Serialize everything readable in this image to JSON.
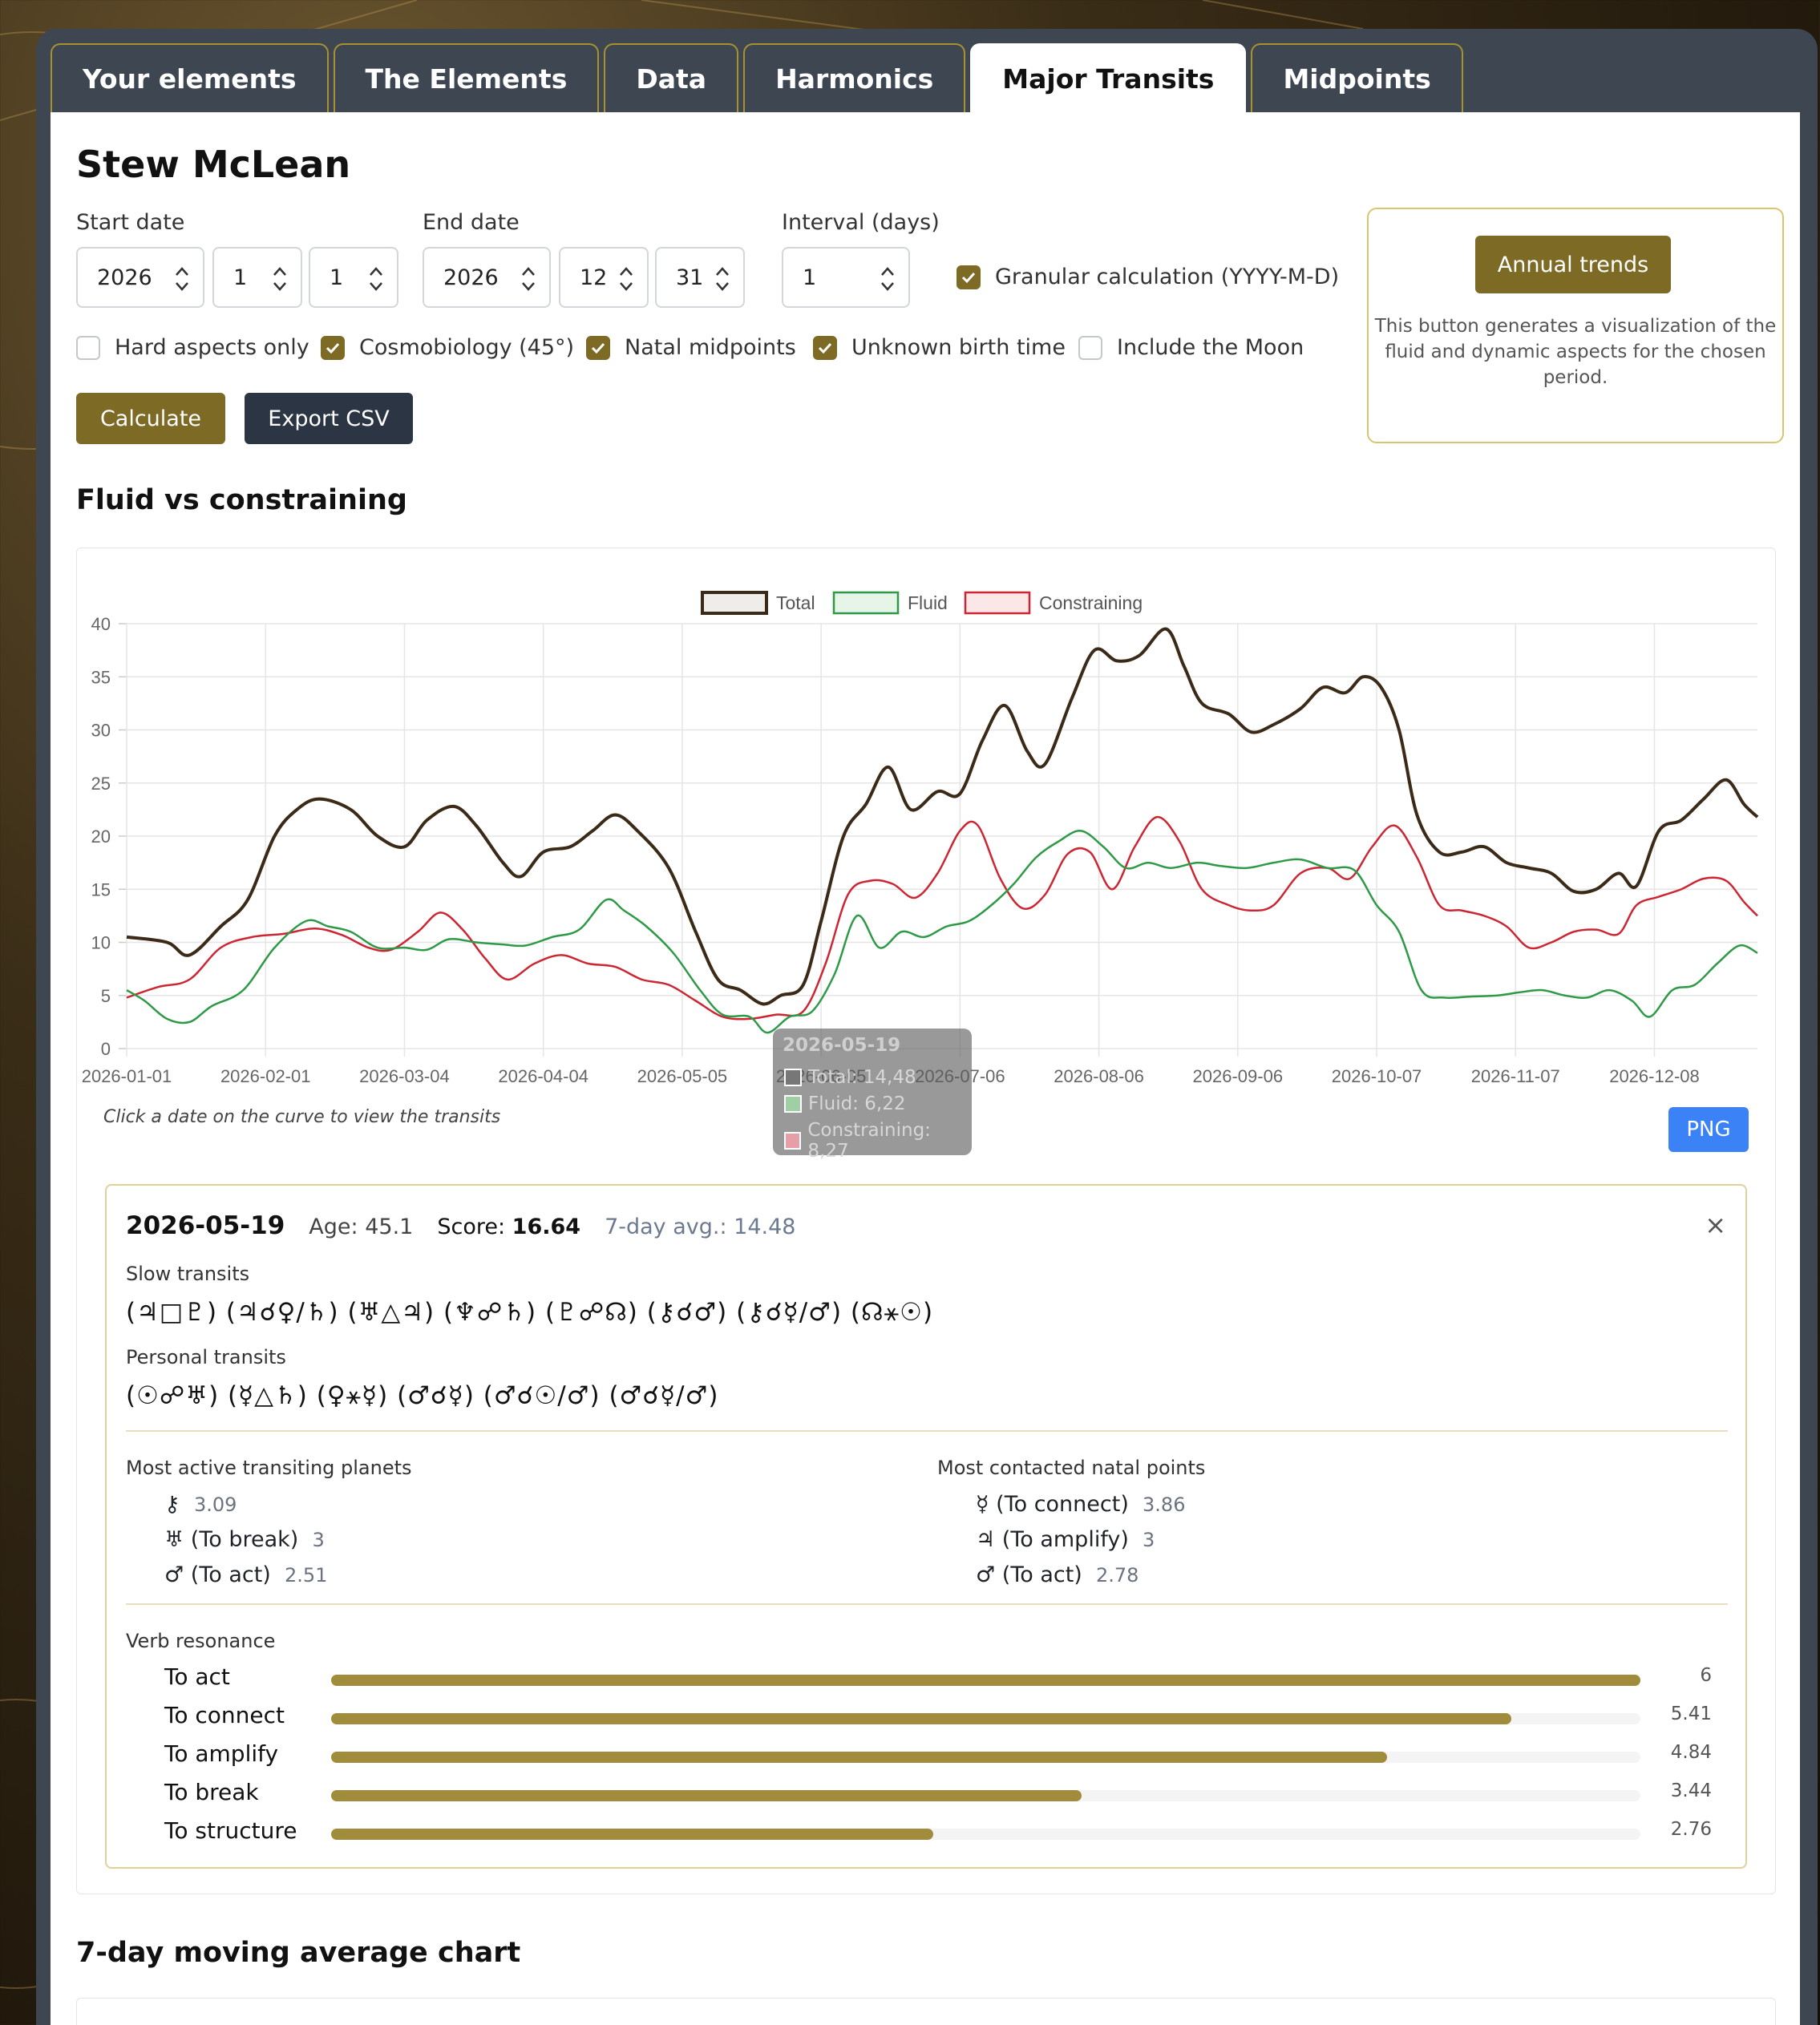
{
  "tabs": [
    {
      "label": "Your elements",
      "active": false
    },
    {
      "label": "The Elements",
      "active": false
    },
    {
      "label": "Data",
      "active": false
    },
    {
      "label": "Harmonics",
      "active": false
    },
    {
      "label": "Major Transits",
      "active": true
    },
    {
      "label": "Midpoints",
      "active": false
    }
  ],
  "person_name": "Stew McLean",
  "form": {
    "start_label": "Start date",
    "start": {
      "year": "2026",
      "month": "1",
      "day": "1"
    },
    "end_label": "End date",
    "end": {
      "year": "2026",
      "month": "12",
      "day": "31"
    },
    "interval_label": "Interval (days)",
    "interval": "1",
    "granular_label": "Granular calculation (YYYY-M-D)",
    "options": {
      "hard_aspects": "Hard aspects only",
      "cosmobiology": "Cosmobiology (45°)",
      "natal_midpoints": "Natal midpoints",
      "unknown_birth": "Unknown birth time",
      "include_moon": "Include the Moon"
    },
    "calculate_label": "Calculate",
    "export_label": "Export CSV"
  },
  "trends": {
    "button_label": "Annual trends",
    "line1": "This button generates a visualization of the",
    "line2": "fluid and dynamic aspects for the chosen",
    "line3": "period."
  },
  "chart_title": "Fluid vs constraining",
  "chart_hint": "Click a date on the curve to view the transits",
  "png_label": "PNG",
  "colors": {
    "accent": "#7d6a24",
    "dark": "#2c3544",
    "blue": "#3b82f6",
    "total": "#3b2a17",
    "fluid": "#2e9a47",
    "constraining": "#cc2633"
  },
  "tooltip": {
    "date": "2026-05-19",
    "total": "Total: 14,48",
    "fluid": "Fluid: 6,22",
    "constraining": "Constraining: 8,27"
  },
  "chart_data": {
    "type": "line",
    "legend": [
      "Total",
      "Fluid",
      "Constraining"
    ],
    "legend_placement": "top",
    "ylim": [
      0,
      40
    ],
    "y_ticks": [
      "0",
      "5",
      "10",
      "15",
      "20",
      "25",
      "30",
      "35",
      "40"
    ],
    "x_ticks": [
      "2026-01-01",
      "2026-02-01",
      "2026-03-04",
      "2026-04-04",
      "2026-05-05",
      "2026-06-05",
      "2026-07-06",
      "2026-08-06",
      "2026-09-06",
      "2026-10-07",
      "2026-11-07",
      "2026-12-08"
    ],
    "grid": true,
    "series": [
      {
        "name": "Total",
        "points": [
          [
            "2026-01-01",
            10.5
          ],
          [
            "2026-01-10",
            10
          ],
          [
            "2026-01-15",
            8.8
          ],
          [
            "2026-01-22",
            11.5
          ],
          [
            "2026-01-28",
            14
          ],
          [
            "2026-02-03",
            20
          ],
          [
            "2026-02-08",
            22.5
          ],
          [
            "2026-02-13",
            23.5
          ],
          [
            "2026-02-20",
            22.5
          ],
          [
            "2026-02-26",
            20
          ],
          [
            "2026-03-04",
            19
          ],
          [
            "2026-03-09",
            21.5
          ],
          [
            "2026-03-15",
            22.8
          ],
          [
            "2026-03-20",
            21
          ],
          [
            "2026-03-26",
            17.5
          ],
          [
            "2026-03-30",
            16.2
          ],
          [
            "2026-04-04",
            18.5
          ],
          [
            "2026-04-10",
            19
          ],
          [
            "2026-04-15",
            20.5
          ],
          [
            "2026-04-20",
            22
          ],
          [
            "2026-04-25",
            20.5
          ],
          [
            "2026-05-02",
            17
          ],
          [
            "2026-05-08",
            11
          ],
          [
            "2026-05-13",
            6.5
          ],
          [
            "2026-05-18",
            5.5
          ],
          [
            "2026-05-23",
            4.2
          ],
          [
            "2026-05-27",
            5
          ],
          [
            "2026-06-01",
            6
          ],
          [
            "2026-06-05",
            12
          ],
          [
            "2026-06-10",
            20
          ],
          [
            "2026-06-15",
            23
          ],
          [
            "2026-06-20",
            26.5
          ],
          [
            "2026-06-25",
            22.5
          ],
          [
            "2026-07-01",
            24.2
          ],
          [
            "2026-07-06",
            24
          ],
          [
            "2026-07-11",
            29
          ],
          [
            "2026-07-16",
            32.3
          ],
          [
            "2026-07-21",
            28
          ],
          [
            "2026-07-25",
            26.8
          ],
          [
            "2026-07-31",
            33
          ],
          [
            "2026-08-05",
            37.5
          ],
          [
            "2026-08-10",
            36.5
          ],
          [
            "2026-08-15",
            37
          ],
          [
            "2026-08-21",
            39.5
          ],
          [
            "2026-08-25",
            36
          ],
          [
            "2026-08-29",
            32.5
          ],
          [
            "2026-09-04",
            31.5
          ],
          [
            "2026-09-09",
            29.8
          ],
          [
            "2026-09-14",
            30.5
          ],
          [
            "2026-09-20",
            32
          ],
          [
            "2026-09-25",
            34
          ],
          [
            "2026-09-30",
            33.5
          ],
          [
            "2026-10-04",
            35
          ],
          [
            "2026-10-08",
            34
          ],
          [
            "2026-10-12",
            30
          ],
          [
            "2026-10-16",
            22
          ],
          [
            "2026-10-21",
            18.5
          ],
          [
            "2026-10-26",
            18.5
          ],
          [
            "2026-10-31",
            19
          ],
          [
            "2026-11-05",
            17.5
          ],
          [
            "2026-11-10",
            17
          ],
          [
            "2026-11-15",
            16.5
          ],
          [
            "2026-11-20",
            14.8
          ],
          [
            "2026-11-25",
            15
          ],
          [
            "2026-11-30",
            16.5
          ],
          [
            "2026-12-04",
            15.3
          ],
          [
            "2026-12-09",
            20.5
          ],
          [
            "2026-12-14",
            21.5
          ],
          [
            "2026-12-19",
            23.5
          ],
          [
            "2026-12-24",
            25.3
          ],
          [
            "2026-12-28",
            23
          ],
          [
            "2026-12-31",
            21.8
          ]
        ]
      },
      {
        "name": "Fluid",
        "points": [
          [
            "2026-01-01",
            5.5
          ],
          [
            "2026-01-05",
            4.5
          ],
          [
            "2026-01-10",
            2.8
          ],
          [
            "2026-01-15",
            2.5
          ],
          [
            "2026-01-20",
            4
          ],
          [
            "2026-01-27",
            5.5
          ],
          [
            "2026-02-03",
            9.5
          ],
          [
            "2026-02-10",
            12
          ],
          [
            "2026-02-15",
            11.5
          ],
          [
            "2026-02-20",
            11
          ],
          [
            "2026-02-26",
            9.5
          ],
          [
            "2026-03-04",
            9.5
          ],
          [
            "2026-03-09",
            9.3
          ],
          [
            "2026-03-14",
            10.3
          ],
          [
            "2026-03-20",
            10
          ],
          [
            "2026-03-26",
            9.8
          ],
          [
            "2026-03-31",
            9.7
          ],
          [
            "2026-04-06",
            10.5
          ],
          [
            "2026-04-12",
            11.2
          ],
          [
            "2026-04-18",
            14
          ],
          [
            "2026-04-22",
            13
          ],
          [
            "2026-04-27",
            11.5
          ],
          [
            "2026-05-03",
            9
          ],
          [
            "2026-05-09",
            5.5
          ],
          [
            "2026-05-14",
            3.2
          ],
          [
            "2026-05-20",
            3
          ],
          [
            "2026-05-24",
            1.5
          ],
          [
            "2026-05-29",
            3
          ],
          [
            "2026-06-03",
            3.5
          ],
          [
            "2026-06-08",
            7
          ],
          [
            "2026-06-13",
            12.5
          ],
          [
            "2026-06-18",
            9.5
          ],
          [
            "2026-06-23",
            11
          ],
          [
            "2026-06-28",
            10.5
          ],
          [
            "2026-07-03",
            11.5
          ],
          [
            "2026-07-08",
            12
          ],
          [
            "2026-07-13",
            13.5
          ],
          [
            "2026-07-18",
            15.5
          ],
          [
            "2026-07-23",
            18
          ],
          [
            "2026-07-28",
            19.5
          ],
          [
            "2026-08-02",
            20.5
          ],
          [
            "2026-08-07",
            19
          ],
          [
            "2026-08-12",
            17
          ],
          [
            "2026-08-17",
            17.5
          ],
          [
            "2026-08-22",
            17
          ],
          [
            "2026-08-28",
            17.5
          ],
          [
            "2026-09-02",
            17.2
          ],
          [
            "2026-09-08",
            17
          ],
          [
            "2026-09-14",
            17.5
          ],
          [
            "2026-09-20",
            17.8
          ],
          [
            "2026-09-26",
            17
          ],
          [
            "2026-10-02",
            16.8
          ],
          [
            "2026-10-07",
            13.5
          ],
          [
            "2026-10-12",
            11
          ],
          [
            "2026-10-17",
            5.5
          ],
          [
            "2026-10-22",
            4.8
          ],
          [
            "2026-10-28",
            4.9
          ],
          [
            "2026-11-03",
            5
          ],
          [
            "2026-11-08",
            5.3
          ],
          [
            "2026-11-13",
            5.5
          ],
          [
            "2026-11-18",
            5
          ],
          [
            "2026-11-23",
            4.8
          ],
          [
            "2026-11-28",
            5.5
          ],
          [
            "2026-12-03",
            4.5
          ],
          [
            "2026-12-07",
            3
          ],
          [
            "2026-12-12",
            5.5
          ],
          [
            "2026-12-17",
            6
          ],
          [
            "2026-12-22",
            8
          ],
          [
            "2026-12-27",
            9.7
          ],
          [
            "2026-12-31",
            9
          ]
        ]
      },
      {
        "name": "Constraining",
        "points": [
          [
            "2026-01-01",
            4.8
          ],
          [
            "2026-01-08",
            5.8
          ],
          [
            "2026-01-15",
            6.5
          ],
          [
            "2026-01-22",
            9.5
          ],
          [
            "2026-01-29",
            10.5
          ],
          [
            "2026-02-05",
            10.8
          ],
          [
            "2026-02-12",
            11.3
          ],
          [
            "2026-02-18",
            10.7
          ],
          [
            "2026-02-24",
            9.5
          ],
          [
            "2026-03-01",
            9.3
          ],
          [
            "2026-03-07",
            11
          ],
          [
            "2026-03-12",
            12.8
          ],
          [
            "2026-03-17",
            11.2
          ],
          [
            "2026-03-22",
            8.5
          ],
          [
            "2026-03-27",
            6.5
          ],
          [
            "2026-04-02",
            8
          ],
          [
            "2026-04-08",
            8.8
          ],
          [
            "2026-04-14",
            8
          ],
          [
            "2026-04-20",
            7.7
          ],
          [
            "2026-04-26",
            6.5
          ],
          [
            "2026-05-02",
            6
          ],
          [
            "2026-05-08",
            4.5
          ],
          [
            "2026-05-14",
            3
          ],
          [
            "2026-05-20",
            2.8
          ],
          [
            "2026-05-26",
            3.2
          ],
          [
            "2026-06-01",
            3.5
          ],
          [
            "2026-06-06",
            8
          ],
          [
            "2026-06-11",
            14.5
          ],
          [
            "2026-06-16",
            15.8
          ],
          [
            "2026-06-21",
            15.5
          ],
          [
            "2026-06-26",
            14.2
          ],
          [
            "2026-07-01",
            16.5
          ],
          [
            "2026-07-06",
            20.5
          ],
          [
            "2026-07-10",
            21
          ],
          [
            "2026-07-15",
            16
          ],
          [
            "2026-07-20",
            13.2
          ],
          [
            "2026-07-25",
            14.5
          ],
          [
            "2026-07-30",
            18.3
          ],
          [
            "2026-08-04",
            18.5
          ],
          [
            "2026-08-09",
            15
          ],
          [
            "2026-08-14",
            19
          ],
          [
            "2026-08-19",
            21.8
          ],
          [
            "2026-08-24",
            19.5
          ],
          [
            "2026-08-29",
            15
          ],
          [
            "2026-09-04",
            13.5
          ],
          [
            "2026-09-09",
            13
          ],
          [
            "2026-09-14",
            13.5
          ],
          [
            "2026-09-20",
            16.5
          ],
          [
            "2026-09-26",
            17
          ],
          [
            "2026-10-01",
            16
          ],
          [
            "2026-10-06",
            19
          ],
          [
            "2026-10-11",
            21
          ],
          [
            "2026-10-16",
            18
          ],
          [
            "2026-10-21",
            13.5
          ],
          [
            "2026-10-26",
            13
          ],
          [
            "2026-10-31",
            12.5
          ],
          [
            "2026-11-05",
            11.5
          ],
          [
            "2026-11-10",
            9.5
          ],
          [
            "2026-11-15",
            10
          ],
          [
            "2026-11-20",
            11
          ],
          [
            "2026-11-25",
            11.2
          ],
          [
            "2026-11-30",
            10.8
          ],
          [
            "2026-12-04",
            13.5
          ],
          [
            "2026-12-09",
            14.3
          ],
          [
            "2026-12-14",
            15
          ],
          [
            "2026-12-19",
            16
          ],
          [
            "2026-12-24",
            15.8
          ],
          [
            "2026-12-28",
            13.8
          ],
          [
            "2026-12-31",
            12.5
          ]
        ]
      }
    ]
  },
  "detail": {
    "date": "2026-05-19",
    "age_label": "Age:",
    "age": "45.1",
    "score_label": "Score:",
    "score": "16.64",
    "avg_label": "7-day avg.:",
    "avg": "14.48",
    "close": "×",
    "slow_label": "Slow transits",
    "slow": "(♃□♇) (♃☌♀/♄) (♅△♃) (♆☍♄) (♇☍☊) (⚷☌♂) (⚷☌☿/♂) (☊⚹☉)",
    "personal_label": "Personal transits",
    "personal": "(☉☍♅) (☿△♄) (♀⚹☿) (♂☌☿) (♂☌☉/♂) (♂☌☿/♂)",
    "planets_label": "Most active transiting planets",
    "planets": [
      {
        "text": "⚷",
        "value": "3.09"
      },
      {
        "text": "♅ (To break)",
        "value": "3"
      },
      {
        "text": "♂ (To act)",
        "value": "2.51"
      }
    ],
    "points_label": "Most contacted natal points",
    "points": [
      {
        "text": "☿ (To connect)",
        "value": "3.86"
      },
      {
        "text": "♃ (To amplify)",
        "value": "3"
      },
      {
        "text": "♂ (To act)",
        "value": "2.78"
      }
    ],
    "verb_label": "Verb resonance",
    "verbs": [
      {
        "label": "To act",
        "value": "6",
        "fraction": 1.0
      },
      {
        "label": "To connect",
        "value": "5.41",
        "fraction": 0.9017
      },
      {
        "label": "To amplify",
        "value": "4.84",
        "fraction": 0.8067
      },
      {
        "label": "To break",
        "value": "3.44",
        "fraction": 0.5733
      },
      {
        "label": "To structure",
        "value": "2.76",
        "fraction": 0.46
      }
    ]
  },
  "avg_chart_title": "7-day moving average chart"
}
